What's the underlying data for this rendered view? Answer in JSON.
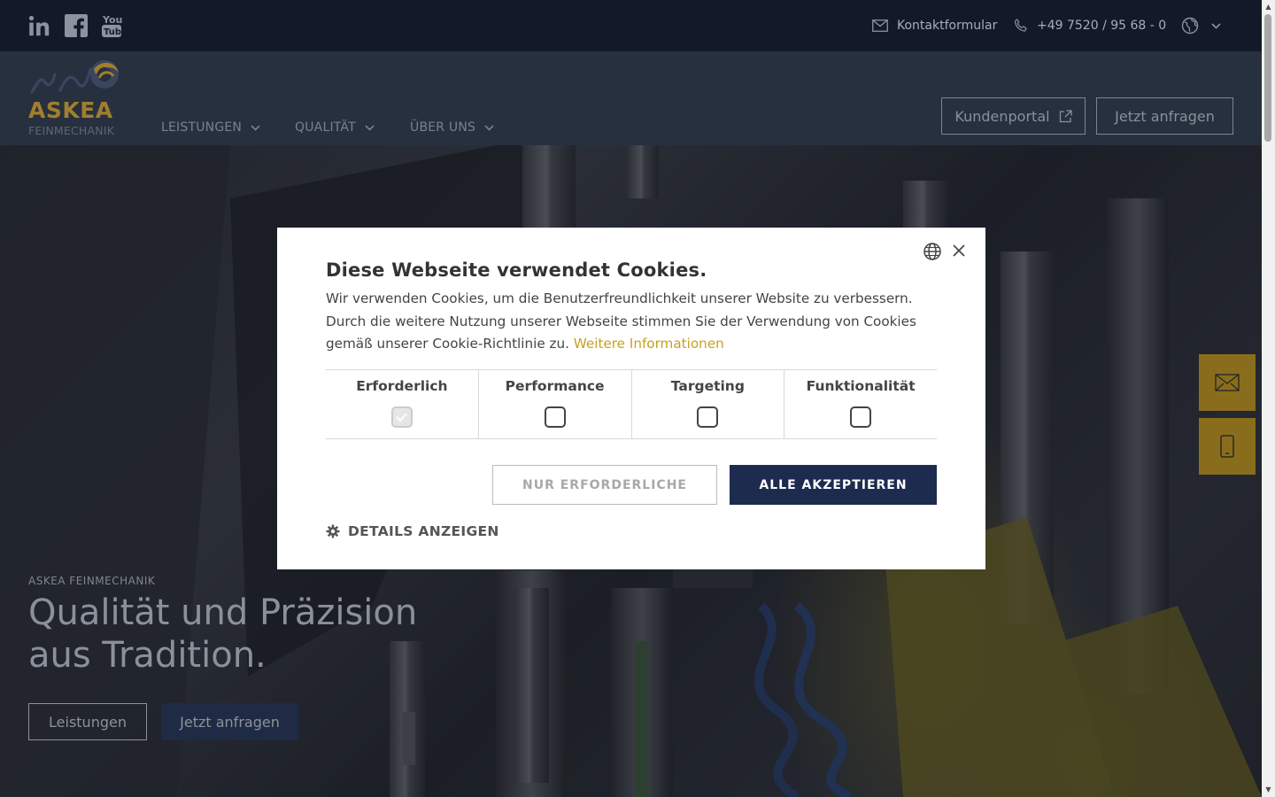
{
  "topbar": {
    "social": [
      "linkedin-icon",
      "facebook-icon",
      "youtube-icon"
    ],
    "contact_label": "Kontaktformular",
    "phone_label": "+49 7520 / 95 68 - 0"
  },
  "header": {
    "logo_text": "ASKEA",
    "logo_sub": "FEINMECHANIK",
    "nav": [
      {
        "label": "LEISTUNGEN"
      },
      {
        "label": "QUALITÄT"
      },
      {
        "label": "ÜBER UNS"
      }
    ],
    "portal_label": "Kundenportal",
    "request_label": "Jetzt anfragen"
  },
  "hero": {
    "overline": "ASKEA FEINMECHANIK",
    "title": "Qualität und Präzision aus Tradition.",
    "btn_services": "Leistungen",
    "btn_request": "Jetzt anfragen"
  },
  "cookie": {
    "title": "Diese Webseite verwendet Cookies.",
    "text": "Wir verwenden Cookies, um die Benutzerfreundlichkeit unserer Website zu verbessern. Durch die weitere Nutzung unserer Webseite stimmen Sie der Verwendung von Cookies gemäß unserer Cookie-Richtlinie zu.",
    "more_info": "Weitere Informationen",
    "categories": [
      {
        "label": "Erforderlich",
        "checked": true
      },
      {
        "label": "Performance",
        "checked": false
      },
      {
        "label": "Targeting",
        "checked": false
      },
      {
        "label": "Funktionalität",
        "checked": false
      }
    ],
    "btn_necessary": "NUR ERFORDERLICHE",
    "btn_accept": "ALLE AKZEPTIEREN",
    "details_label": "DETAILS ANZEIGEN"
  },
  "colors": {
    "accent_gold": "#c9a020",
    "accept_navy": "#1d2b4f",
    "side_button_gold": "#8a6d1c"
  }
}
